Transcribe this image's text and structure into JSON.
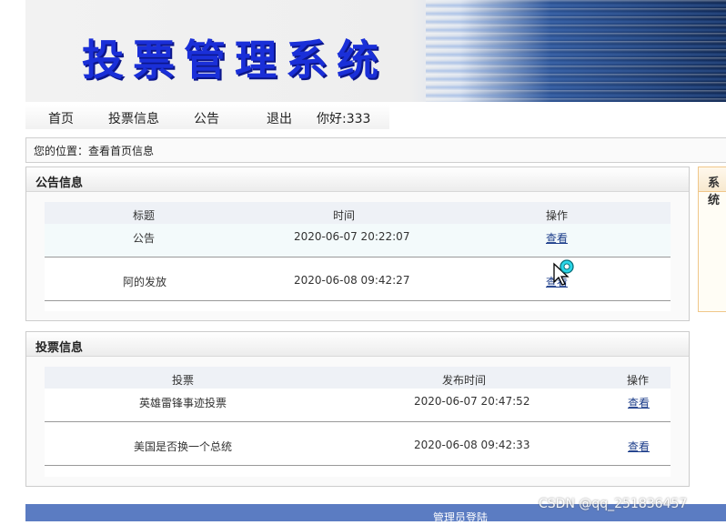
{
  "header": {
    "title": "投票管理系统"
  },
  "nav": {
    "items": [
      "首页",
      "投票信息",
      "公告",
      "退出"
    ],
    "greeting": "你好:333"
  },
  "breadcrumb": "您的位置：查看首页信息",
  "notice_panel": {
    "title": "公告信息",
    "columns": [
      "标题",
      "时间",
      "操作"
    ],
    "rows": [
      {
        "title": "公告",
        "time": "2020-06-07 20:22:07",
        "action": "查看"
      },
      {
        "title": "阿的发放",
        "time": "2020-06-08 09:42:27",
        "action": "查看"
      }
    ]
  },
  "vote_panel": {
    "title": "投票信息",
    "columns": [
      "投票",
      "发布时间",
      "操作"
    ],
    "rows": [
      {
        "title": "英雄雷锋事迹投票",
        "time": "2020-06-07 20:47:52",
        "action": "查看"
      },
      {
        "title": "美国是否换一个总统",
        "time": "2020-06-08 09:42:33",
        "action": "查看"
      }
    ]
  },
  "side_panel": {
    "title": "系统"
  },
  "footer": {
    "label": "管理员登陆"
  },
  "watermark": "CSDN @qq_251836457",
  "colors": {
    "title": "#1a2fd8",
    "link": "#1c3d8a",
    "footer": "#5b7cc2"
  }
}
